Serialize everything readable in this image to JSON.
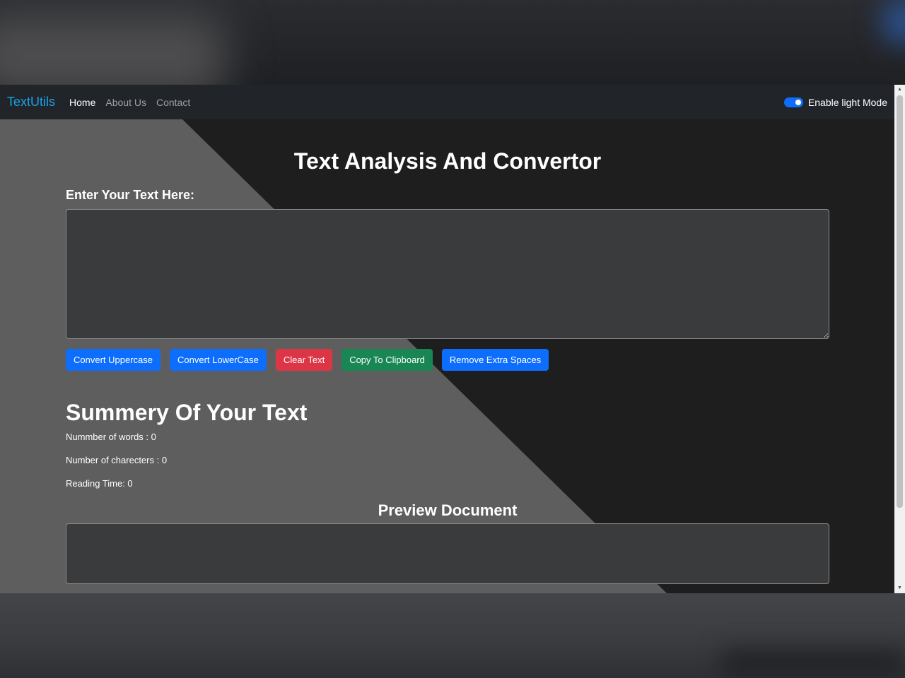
{
  "navbar": {
    "brand": "TextUtils",
    "links": [
      "Home",
      "About Us",
      "Contact"
    ],
    "mode_toggle_label": "Enable light Mode"
  },
  "main": {
    "title": "Text Analysis And Convertor",
    "input_label": "Enter Your Text Here:",
    "input_value": "",
    "buttons": {
      "uppercase": "Convert Uppercase",
      "lowercase": "Convert LowerCase",
      "clear": "Clear Text",
      "copy": "Copy To Clipboard",
      "remove_spaces": "Remove Extra Spaces"
    }
  },
  "summary": {
    "title": "Summery Of Your Text",
    "words": "Nummber of words : 0",
    "characters": "Number of charecters : 0",
    "reading_time": "Reading Time: 0"
  },
  "preview": {
    "title": "Preview Document",
    "content": ""
  },
  "colors": {
    "brand": "#1aa3e8",
    "primary": "#0d6efd",
    "danger": "#dc3545",
    "success": "#198754",
    "background_dark": "#1e1e1e",
    "background_diagonal": "#5e5e5e"
  },
  "icons": {
    "scroll_up": "triangle-up-icon",
    "scroll_down": "triangle-down-icon"
  }
}
